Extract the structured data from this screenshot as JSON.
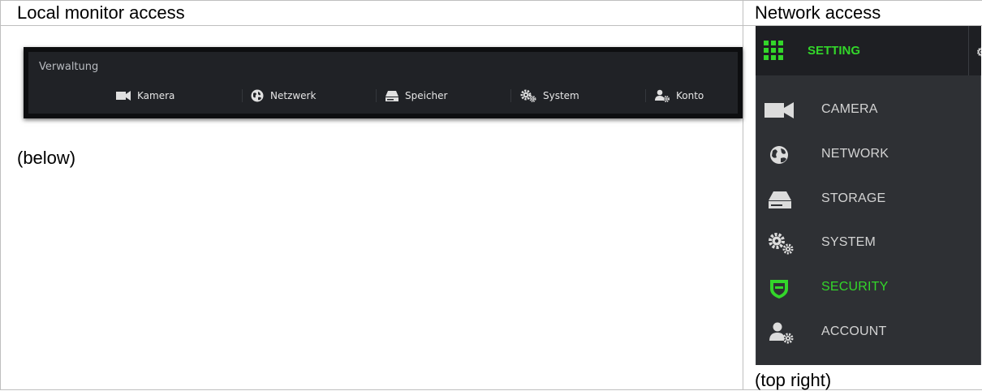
{
  "columns": {
    "left_header": "Local monitor access",
    "right_header": "Network access"
  },
  "local_panel": {
    "title": "Verwaltung",
    "items": [
      {
        "label": "Kamera",
        "icon": "camera-icon"
      },
      {
        "label": "Netzwerk",
        "icon": "network-globe-icon"
      },
      {
        "label": "Speicher",
        "icon": "storage-drive-icon"
      },
      {
        "label": "System",
        "icon": "system-gears-icon"
      },
      {
        "label": "Konto",
        "icon": "account-user-gear-icon"
      }
    ],
    "caption": "(below)"
  },
  "network_menu": {
    "setting_label": "SETTING",
    "setting_icon": "grid-menu-icon",
    "items": [
      {
        "label": "CAMERA",
        "icon": "camera-icon",
        "active": false
      },
      {
        "label": "NETWORK",
        "icon": "network-globe-icon",
        "active": false
      },
      {
        "label": "STORAGE",
        "icon": "storage-drive-icon",
        "active": false
      },
      {
        "label": "SYSTEM",
        "icon": "system-gears-icon",
        "active": false
      },
      {
        "label": "SECURITY",
        "icon": "shield-icon",
        "active": true
      },
      {
        "label": "ACCOUNT",
        "icon": "account-user-gear-icon",
        "active": false
      }
    ],
    "caption": "(top right)"
  },
  "colors": {
    "accent_green": "#33d62a",
    "menu_background": "#2e3034",
    "panel_background": "#202226"
  }
}
